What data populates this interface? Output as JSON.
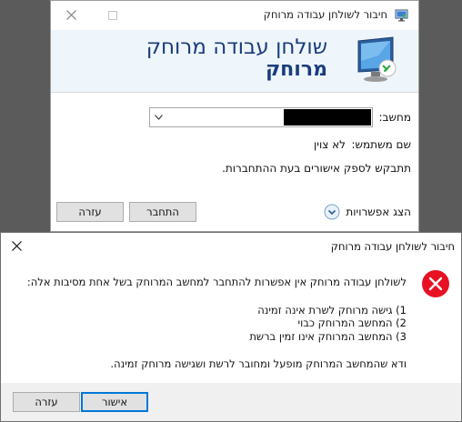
{
  "rdc_window": {
    "title": "חיבור לשולחן עבודה מרוחק",
    "banner_line1": "שולחן עבודה מרוחק",
    "banner_line2": "מרוחק",
    "computer_label": "מחשב:",
    "computer_value_redacted": true,
    "username_label": "שם משתמש:",
    "username_value": "לא צוין",
    "credentials_note": "תתבקש לספק אישורים בעת ההתחברות.",
    "show_options_label": "הצג אפשרויות",
    "connect_button": "התחבר",
    "help_button": "עזרה",
    "icons": {
      "app": "remote-desktop-icon",
      "banner": "monitor-connection-icon",
      "close": "close-icon",
      "maximize": "maximize-icon",
      "dropdown": "chevron-down-icon",
      "options": "expand-options-icon"
    }
  },
  "error_dialog": {
    "title": "חיבור לשולחן עבודה מרוחק",
    "message": "לשולחן עבודה מרוחק אין אפשרות להתחבר למחשב המרוחק בשל אחת מסיבות אלה:",
    "reasons": [
      "1) גישה מרוחק לשרת אינה זמינה",
      "2) המחשב המרוחק כבוי",
      "3) המחשב המרוחק אינו זמין ברשת"
    ],
    "advice": "ודא שהמחשב המרוחק מופעל ומחובר לרשת ושגישה מרוחק זמינה.",
    "ok_button": "אישור",
    "help_button": "עזרה",
    "icons": {
      "error": "error-icon",
      "close": "close-icon"
    }
  },
  "colors": {
    "banner_text": "#1a3d7a",
    "banner_bg": "#eef5fb",
    "error_red": "#e81123",
    "default_button_border": "#0078d7"
  }
}
